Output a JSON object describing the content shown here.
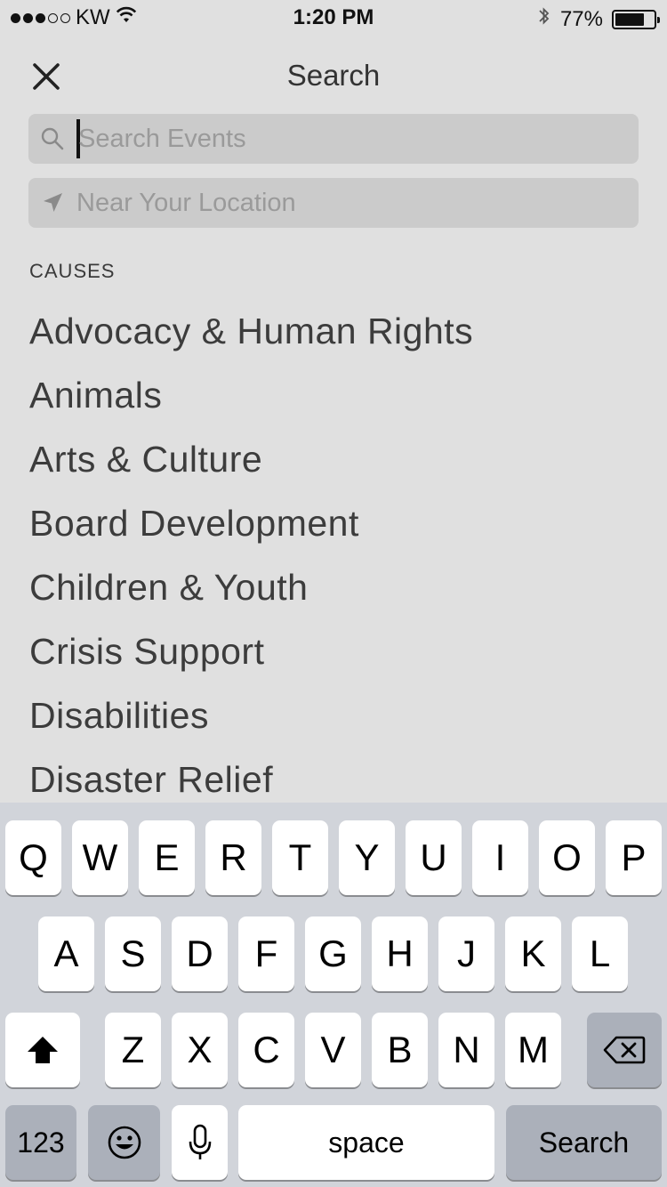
{
  "status_bar": {
    "carrier": "KW",
    "time": "1:20 PM",
    "battery_percent": "77%",
    "battery_level": 0.77,
    "signal_bars_filled": 3,
    "signal_bars_total": 5
  },
  "header": {
    "title": "Search"
  },
  "search": {
    "placeholder": "Search Events",
    "value": ""
  },
  "location": {
    "placeholder": "Near Your Location",
    "value": ""
  },
  "causes": {
    "label": "CAUSES",
    "items": [
      "Advocacy & Human Rights",
      "Animals",
      "Arts & Culture",
      "Board Development",
      "Children & Youth",
      "Crisis Support",
      "Disabilities",
      "Disaster Relief"
    ]
  },
  "keyboard": {
    "row1": [
      "Q",
      "W",
      "E",
      "R",
      "T",
      "Y",
      "U",
      "I",
      "O",
      "P"
    ],
    "row2": [
      "A",
      "S",
      "D",
      "F",
      "G",
      "H",
      "J",
      "K",
      "L"
    ],
    "row3": [
      "Z",
      "X",
      "C",
      "V",
      "B",
      "N",
      "M"
    ],
    "numbers_label": "123",
    "space_label": "space",
    "action_label": "Search"
  },
  "colors": {
    "background": "#e0e0e0",
    "field": "#cbcbcb",
    "keyboard": "#d1d4da",
    "key": "#ffffff",
    "key_dark": "#abb0ba"
  }
}
